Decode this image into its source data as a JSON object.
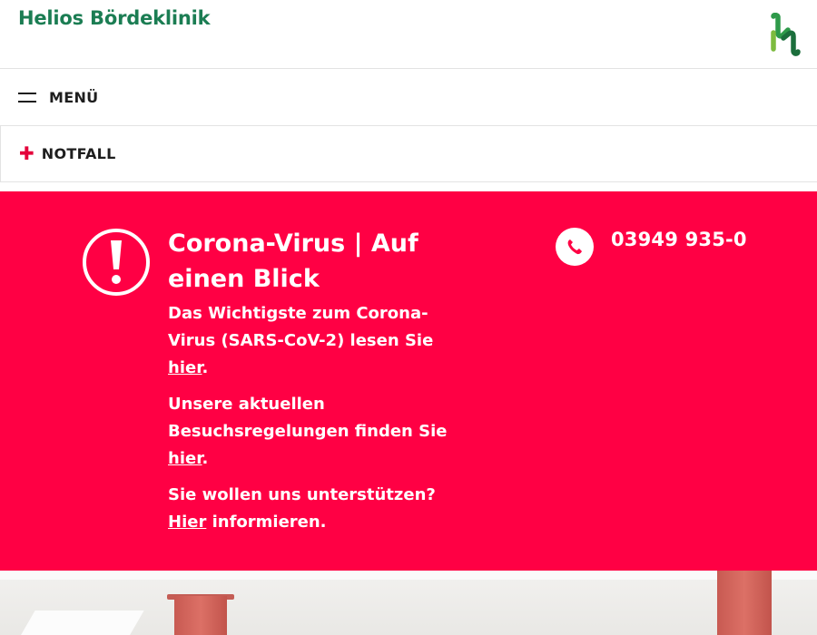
{
  "header": {
    "site_title": "Helios Bördeklinik",
    "logo_icon": "helios-logo-icon"
  },
  "menu": {
    "label": "MENÜ",
    "icon": "hamburger-icon"
  },
  "notfall": {
    "label": "NOTFALL",
    "icon": "plus-icon"
  },
  "alert": {
    "title": "Corona-Virus | Auf einen Blick",
    "p1_text": "Das Wichtigste zum Corona-Virus (SARS-CoV-2) lesen Sie ",
    "p1_link": "hier",
    "p1_end": ".",
    "p2_text": "Unsere aktuellen Besuchsregelungen finden Sie ",
    "p2_link": "hier",
    "p2_end": ".",
    "p3_text": "Sie wollen uns unterstützen? ",
    "p3_link": "Hier",
    "p3_end": " informieren.",
    "icon": "exclamation-circle-icon",
    "background_color": "#ff0044"
  },
  "contact": {
    "phone": "03949 935-0",
    "icon": "phone-icon"
  },
  "colors": {
    "brand_green": "#1b7d53",
    "accent_red": "#e4003a"
  }
}
